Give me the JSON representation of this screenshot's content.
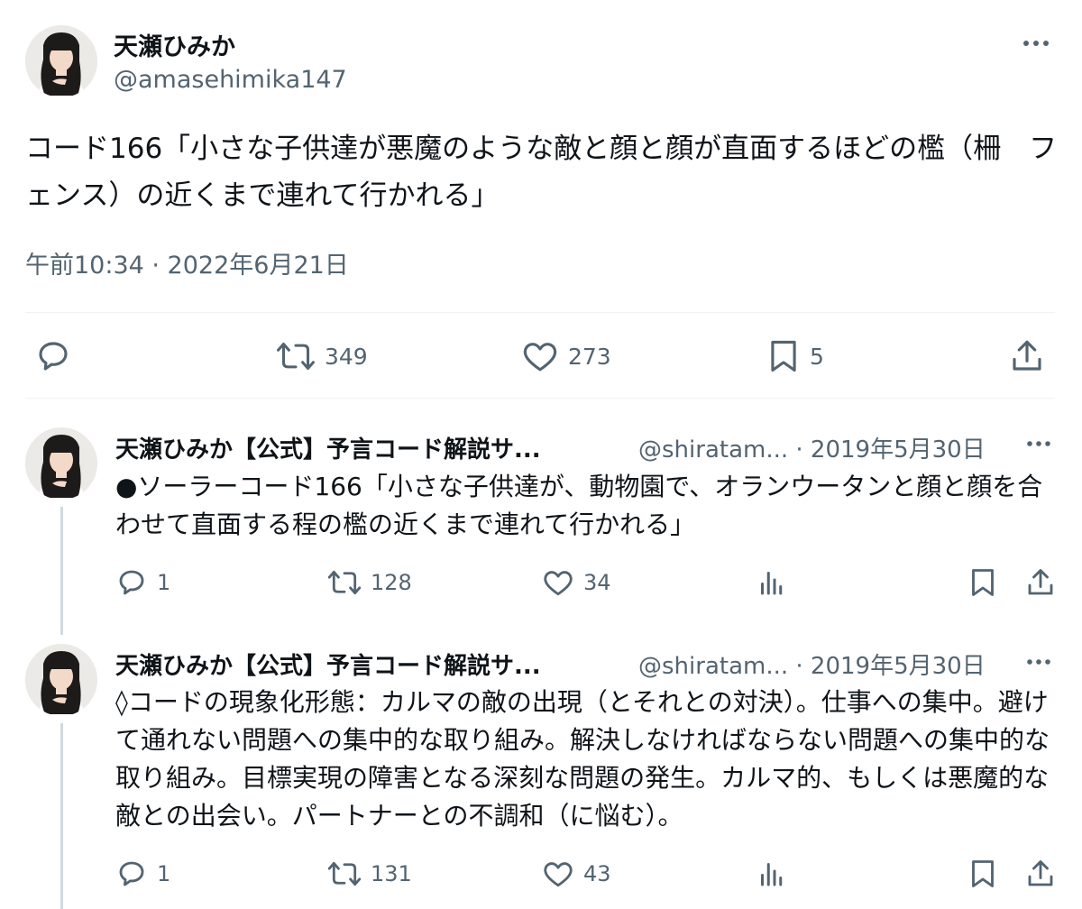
{
  "main_tweet": {
    "author_name": "天瀬ひみか",
    "author_handle": "@amasehimika147",
    "avatar_icon": "avatar-photo",
    "more_icon": "more-dots-icon",
    "text": "コード166「小さな子供達が悪魔のような敵と顔と顔が直面するほどの檻（柵　フェンス）の近くまで連れて行かれる」",
    "timestamp": "午前10:34 · 2022年6月21日",
    "actions": {
      "reply": {
        "icon": "reply-icon",
        "count": ""
      },
      "retweet": {
        "icon": "retweet-icon",
        "count": "349"
      },
      "like": {
        "icon": "heart-icon",
        "count": "273"
      },
      "bookmark": {
        "icon": "bookmark-icon",
        "count": "5"
      },
      "share": {
        "icon": "share-icon"
      }
    }
  },
  "replies": [
    {
      "author_name": "天瀬ひみか【公式】予言コード解説サ...",
      "author_handle": "@shiratam...",
      "date": "· 2019年5月30日",
      "text": "●ソーラーコード166「小さな子供達が、動物園で、オランウータンと顔と顔を合わせて直面する程の檻の近くまで連れて行かれる」",
      "actions": {
        "reply": "1",
        "retweet": "128",
        "like": "34"
      }
    },
    {
      "author_name": "天瀬ひみか【公式】予言コード解説サ...",
      "author_handle": "@shiratam...",
      "date": "· 2019年5月30日",
      "text": "◊コードの現象化形態：カルマの敵の出現（とそれとの対決）。仕事への集中。避けて通れない問題への集中的な取り組み。解決しなければならない問題への集中的な取り組み。目標実現の障害となる深刻な問題の発生。カルマ的、もしくは悪魔的な敵との出会い。パートナーとの不調和（に悩む）。",
      "actions": {
        "reply": "1",
        "retweet": "131",
        "like": "43"
      }
    }
  ]
}
